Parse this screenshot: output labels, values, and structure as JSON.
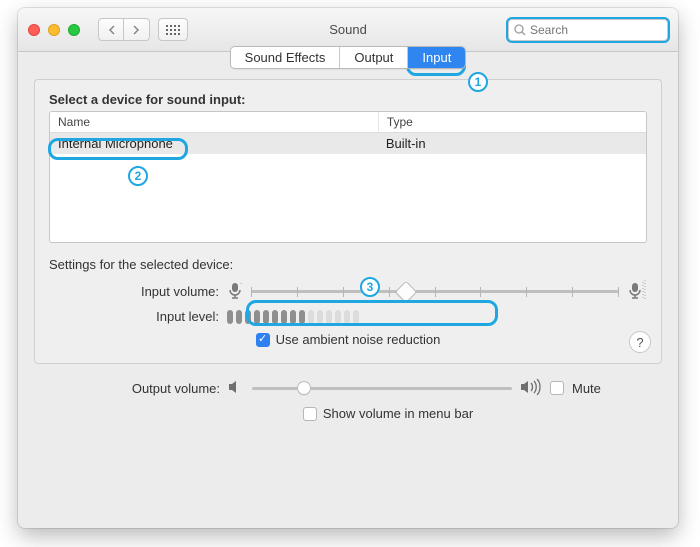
{
  "window": {
    "title": "Sound"
  },
  "search": {
    "placeholder": "Search"
  },
  "tabs": {
    "items": [
      "Sound Effects",
      "Output",
      "Input"
    ],
    "active_index": 2
  },
  "section_label": "Select a device for sound input:",
  "columns": {
    "name": "Name",
    "type": "Type"
  },
  "devices": [
    {
      "name": "Internal Microphone",
      "type": "Built-in"
    }
  ],
  "settings_label": "Settings for the selected device:",
  "input_volume": {
    "label": "Input volume:",
    "value": 0.42
  },
  "input_level": {
    "label": "Input level:",
    "active_bars": 9,
    "total_bars": 15
  },
  "ambient": {
    "label": "Use ambient noise reduction",
    "checked": true
  },
  "output_volume": {
    "label": "Output volume:",
    "value": 0.2,
    "mute_label": "Mute",
    "mute_checked": false
  },
  "menubar": {
    "label": "Show volume in menu bar",
    "checked": false
  },
  "badges": {
    "one": "1",
    "two": "2",
    "three": "3"
  }
}
